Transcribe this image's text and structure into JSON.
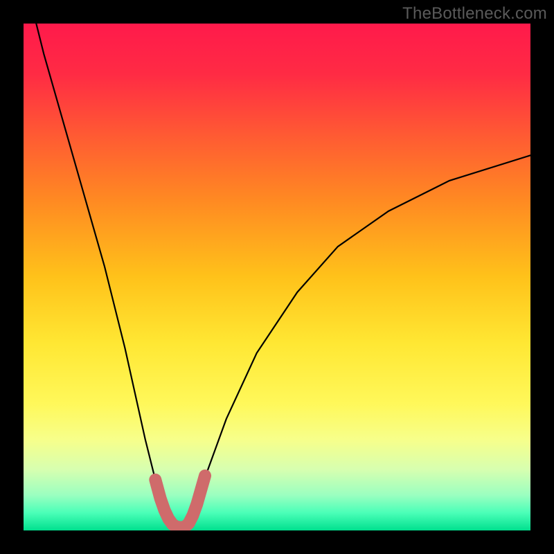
{
  "watermark": "TheBottleneck.com",
  "gradient": {
    "stops": [
      {
        "offset": 0.0,
        "color": "#ff1a4b"
      },
      {
        "offset": 0.1,
        "color": "#ff2b44"
      },
      {
        "offset": 0.22,
        "color": "#ff5a33"
      },
      {
        "offset": 0.35,
        "color": "#ff8a22"
      },
      {
        "offset": 0.5,
        "color": "#ffc21a"
      },
      {
        "offset": 0.63,
        "color": "#ffe733"
      },
      {
        "offset": 0.75,
        "color": "#fff85a"
      },
      {
        "offset": 0.82,
        "color": "#f7ff8a"
      },
      {
        "offset": 0.88,
        "color": "#d7ffb0"
      },
      {
        "offset": 0.93,
        "color": "#9bffc0"
      },
      {
        "offset": 0.965,
        "color": "#4bffb8"
      },
      {
        "offset": 1.0,
        "color": "#00e08e"
      }
    ]
  },
  "chart_data": {
    "type": "line",
    "title": "",
    "xlabel": "",
    "ylabel": "",
    "xlim": [
      0,
      100
    ],
    "ylim": [
      0,
      100
    ],
    "series": [
      {
        "name": "bottleneck-curve",
        "x": [
          0,
          4,
          8,
          12,
          16,
          20,
          22,
          24,
          26,
          27.5,
          29,
          30,
          31,
          32,
          33,
          34,
          36,
          40,
          46,
          54,
          62,
          72,
          84,
          100
        ],
        "y": [
          110,
          94,
          80,
          66,
          52,
          36,
          27,
          18,
          10,
          5,
          2,
          0.8,
          0.6,
          0.8,
          2,
          5,
          11,
          22,
          35,
          47,
          56,
          63,
          69,
          74
        ]
      }
    ],
    "marker": {
      "name": "bottleneck-minimum-marker",
      "color": "#cf6b6b",
      "x": [
        26.0,
        27.0,
        27.8,
        28.6,
        29.4,
        30.2,
        31.0,
        31.8,
        32.6,
        33.4,
        34.2,
        35.0,
        35.8
      ],
      "y": [
        10.0,
        6.3,
        4.0,
        2.3,
        1.2,
        0.7,
        0.6,
        0.7,
        1.4,
        3.0,
        5.2,
        8.0,
        10.8
      ]
    }
  }
}
